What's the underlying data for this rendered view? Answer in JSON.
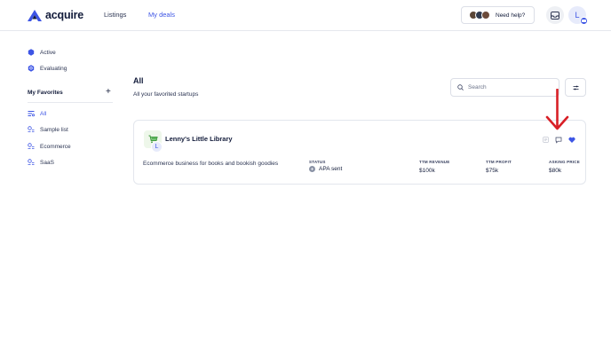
{
  "brand": {
    "name": "acquire",
    "color": "#3d55e5"
  },
  "nav": {
    "listings": "Listings",
    "my_deals": "My deals"
  },
  "header": {
    "help_label": "Need help?",
    "user_initial": "L",
    "inbox_icon": "inbox-icon"
  },
  "sidebar": {
    "items": [
      {
        "label": "Active",
        "icon": "active-icon"
      },
      {
        "label": "Evaluating",
        "icon": "evaluating-icon"
      }
    ],
    "favorites_title": "My Favorites",
    "favorites_add": "+",
    "favorites": [
      {
        "label": "All",
        "icon": "list-icon",
        "active": true
      },
      {
        "label": "Sample list",
        "icon": "list-settings-icon"
      },
      {
        "label": "Ecommerce",
        "icon": "list-settings-icon"
      },
      {
        "label": "SaaS",
        "icon": "list-settings-icon"
      }
    ]
  },
  "main": {
    "title": "All",
    "subtitle": "All your favorited startups",
    "search_placeholder": "Search"
  },
  "card": {
    "name": "Lenny's Little Library",
    "logo_initial": "L",
    "description": "Ecommerce business for books and bookish goodies",
    "columns": [
      {
        "label": "STATUS",
        "value": "APA sent"
      },
      {
        "label": "TTM REVENUE",
        "value": "$100k"
      },
      {
        "label": "TTM PROFIT",
        "value": "$75k"
      },
      {
        "label": "ASKING PRICE",
        "value": "$80k"
      }
    ]
  },
  "colors": {
    "accent": "#3d55e5",
    "arrow": "#d81f26",
    "text": "#131c3b"
  }
}
